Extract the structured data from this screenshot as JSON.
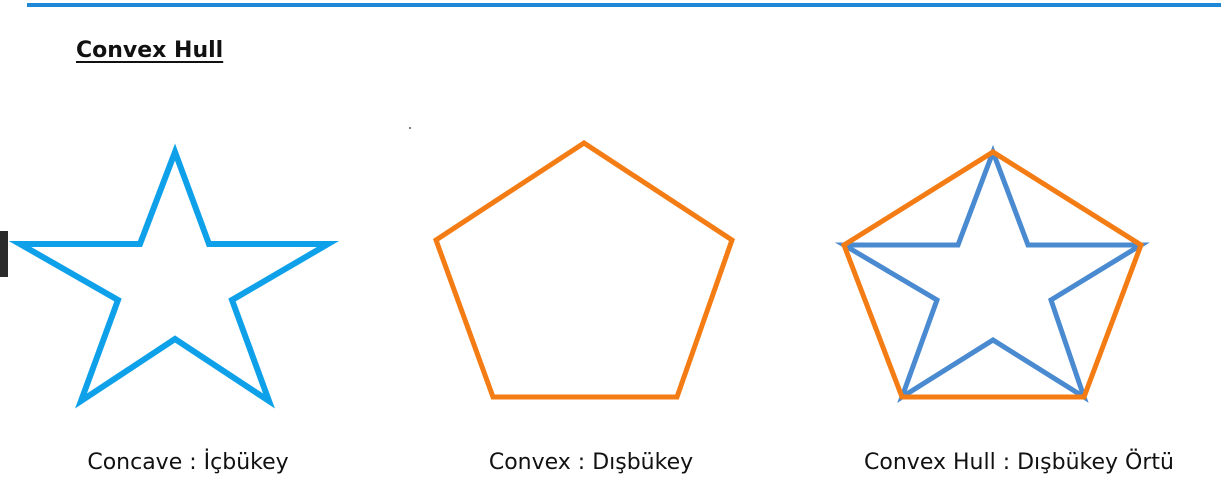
{
  "slide": {
    "title": "Convex Hull",
    "colors": {
      "rule": "#1e88d6",
      "star_concave": "#0ea1ea",
      "pentagon_convex": "#f47c14",
      "star_in_hull": "#4a8ad0",
      "hull": "#f47c14"
    }
  },
  "panels": [
    {
      "caption": "Concave : İçbükey"
    },
    {
      "caption": "Convex : Dışbükey"
    },
    {
      "caption": "Convex Hull : Dışbükey Örtü"
    }
  ]
}
